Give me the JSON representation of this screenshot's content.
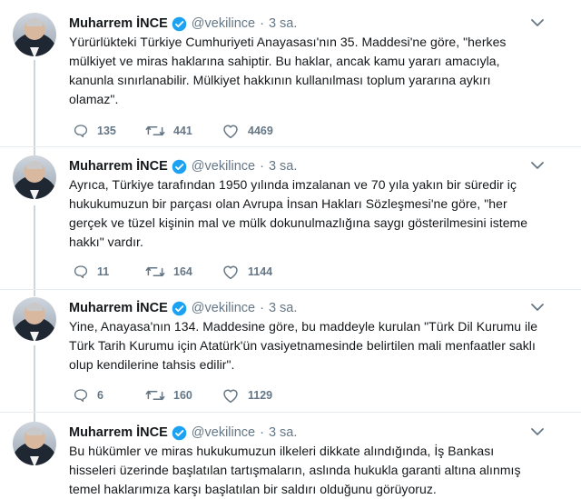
{
  "tweets": [
    {
      "name": "Muharrem İNCE",
      "handle": "@vekilince",
      "time": "3 sa.",
      "text": "Yürürlükteki Türkiye Cumhuriyeti Anayasası'nın 35. Maddesi'ne göre, \"herkes mülkiyet ve miras haklarına sahiptir. Bu haklar, ancak kamu yararı amacıyla, kanunla sınırlanabilir. Mülkiyet hakkının kullanılması toplum yararına aykırı olamaz\".",
      "replies": "135",
      "retweets": "441",
      "likes": "4469"
    },
    {
      "name": "Muharrem İNCE",
      "handle": "@vekilince",
      "time": "3 sa.",
      "text": "Ayrıca, Türkiye tarafından 1950 yılında imzalanan ve 70 yıla yakın bir süredir iç hukukumuzun bir parçası olan Avrupa İnsan Hakları Sözleşmesi'ne göre, \"her gerçek ve tüzel kişinin mal ve mülk dokunulmazlığına saygı gösterilmesini isteme hakkı\" vardır.",
      "replies": "11",
      "retweets": "164",
      "likes": "1144"
    },
    {
      "name": "Muharrem İNCE",
      "handle": "@vekilince",
      "time": "3 sa.",
      "text": "Yine, Anayasa'nın 134. Maddesine göre, bu maddeyle kurulan \"Türk Dil Kurumu ile Türk Tarih Kurumu için Atatürk'ün vasiyetnamesinde belirtilen mali menfaatler saklı olup kendilerine tahsis edilir\".",
      "replies": "6",
      "retweets": "160",
      "likes": "1129"
    },
    {
      "name": "Muharrem İNCE",
      "handle": "@vekilince",
      "time": "3 sa.",
      "text": "Bu hükümler ve miras hukukumuzun ilkeleri dikkate alındığında, İş Bankası hisseleri üzerinde başlatılan tartışmaların, aslında hukukla garanti altına alınmış temel haklarımıza karşı başlatılan bir saldırı olduğunu görüyoruz."
    }
  ],
  "colors": {
    "verified": "#1da1f2",
    "muted": "#657786",
    "thread": "#ccd6dd"
  },
  "icons": [
    "verified-badge-icon",
    "chevron-down-icon",
    "reply-icon",
    "retweet-icon",
    "like-icon"
  ]
}
